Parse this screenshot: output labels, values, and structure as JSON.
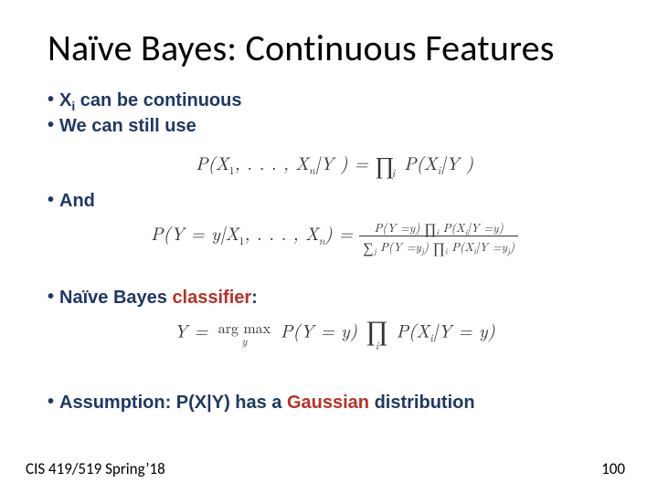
{
  "title": "Naïve Bayes: Continuous Features",
  "bullets": {
    "b1_pre": "X",
    "b1_sub": "i",
    "b1_post": " can be continuous",
    "b2": "We can still use",
    "b3": "And",
    "b4_pre": "Naïve Bayes ",
    "b4_red": "classifier",
    "b4_post": ":",
    "b5_pre": "Assumption: P(X|Y) has a ",
    "b5_red": "Gaussian",
    "b5_post": " distribution"
  },
  "equations": {
    "eq1_lhs": "P(X",
    "eq1_lhs2": ", . . . , X",
    "eq1_lhs3": "|Y ) = ",
    "eq1_rhs_prod": "∏",
    "eq1_rhs_sub": "i",
    "eq1_rhs": " P(X",
    "eq1_rhs2": "|Y )",
    "eq2_lhs": "P(Y = y|X",
    "eq2_lhs2": ", . . . , X",
    "eq2_lhs3": ") = ",
    "eq2_num_a": "P(Y =y) ",
    "eq2_num_prod": "∏",
    "eq2_num_b": " P(X",
    "eq2_num_c": "|Y =y)",
    "eq2_den_sum": "∑",
    "eq2_den_a": " P(Y =y",
    "eq2_den_b": ") ",
    "eq2_den_prod": "∏",
    "eq2_den_c": " P(X",
    "eq2_den_d": "|Y =y",
    "eq2_den_e": ")",
    "eq3_a": "Y = ",
    "eq3_argmax_top": "arg max",
    "eq3_argmax_bot": "y",
    "eq3_b": " P(Y = y) ",
    "eq3_prod": "∏",
    "eq3_prod_sub": "i",
    "eq3_c": " P(X",
    "eq3_d": "|Y = y)"
  },
  "footer": {
    "left": "CIS 419/519 Spring’18",
    "right": "100"
  }
}
